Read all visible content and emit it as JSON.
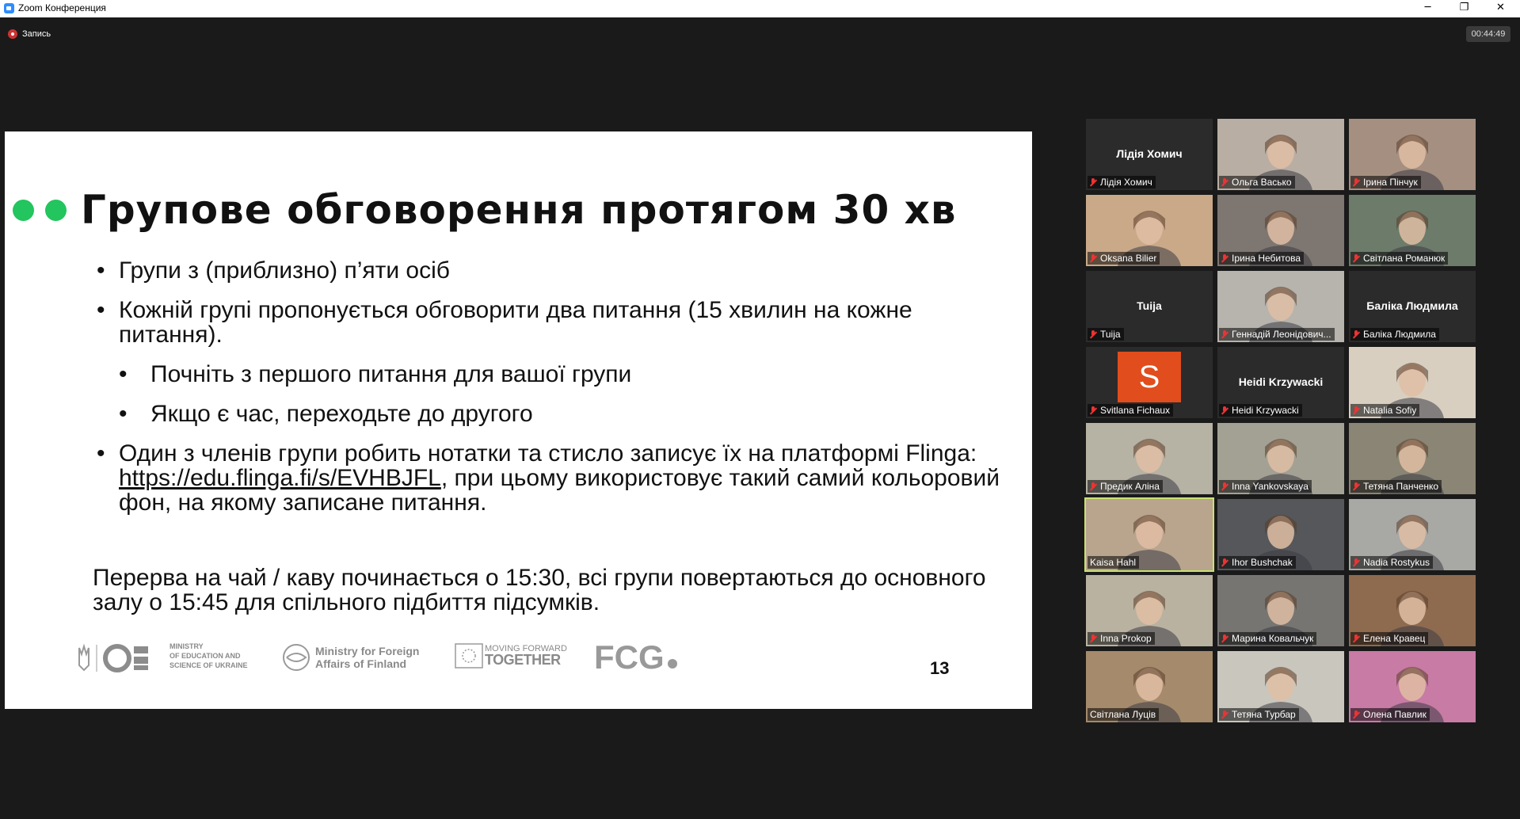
{
  "window": {
    "title": "Zoom Конференция",
    "controls": {
      "minimize": "─",
      "restore": "❐",
      "close": "✕"
    }
  },
  "recording": {
    "label": "Запись"
  },
  "timer": "00:44:49",
  "slide": {
    "title": "Групове обговорення протягом 30 хв",
    "bullets": {
      "b1": "Групи з (приблизно) п’яти осіб",
      "b2": "Кожній групі пропонується обговорити два питання (15 хвилин на кожне питання).",
      "b2a": "Почніть з першого питання для вашої групи",
      "b2b": "Якщо є час, переходьте до другого",
      "b3_pre": "Один з членів групи робить нотатки та стисло записує їх на платформі Flinga: ",
      "b3_link": "https://edu.flinga.fi/s/EVHBJFL",
      "b3_post": ", при цьому використовує такий самий кольоровий фон, на якому записане питання."
    },
    "note": "Перерва на чай / каву починається о 15:30, всі групи повертаються до основного залу о 15:45 для спільного підбиття підсумків.",
    "logos": {
      "ministry_edu": [
        "MINISTRY",
        "OF EDUCATION AND",
        "SCIENCE OF UKRAINE"
      ],
      "ministry_foreign": [
        "Ministry for Foreign",
        "Affairs of Finland"
      ],
      "moving": [
        "MOVING FORWARD",
        "TOGETHER"
      ],
      "fcg": "FCG"
    },
    "page_number": "13"
  },
  "participants": [
    {
      "name": "Лідія Хомич",
      "display": "Лідія Хомич",
      "video": false,
      "muted": true
    },
    {
      "name": "Ольга Васько",
      "video": true,
      "muted": true,
      "bg": "#b9aea3"
    },
    {
      "name": "Ірина Пінчук",
      "video": true,
      "muted": true,
      "bg": "#a58f80"
    },
    {
      "name": "Oksana Bilier",
      "video": true,
      "muted": true,
      "bg": "#c9a988"
    },
    {
      "name": "Ірина Небитова",
      "video": true,
      "muted": true,
      "bg": "#7e7670"
    },
    {
      "name": "Світлана Романюк",
      "video": true,
      "muted": true,
      "bg": "#6d7b6a"
    },
    {
      "name": "Tuija",
      "display": "Tuija",
      "video": false,
      "muted": true
    },
    {
      "name": "Геннадій Леонідович...",
      "video": true,
      "muted": true,
      "bg": "#b7b3ad"
    },
    {
      "name": "Баліка Людмила",
      "display": "Баліка Людмила",
      "video": false,
      "muted": true
    },
    {
      "name": "Svitlana Fichaux",
      "avatar": "S",
      "video": false,
      "muted": true
    },
    {
      "name": "Heidi Krzywacki",
      "display": "Heidi Krzywacki",
      "video": false,
      "muted": true
    },
    {
      "name": "Natalia Sofiy",
      "video": true,
      "muted": true,
      "bg": "#d8cfc0"
    },
    {
      "name": "Предик Аліна",
      "video": true,
      "muted": true,
      "bg": "#b6b2a4"
    },
    {
      "name": "Inna Yankovskaya",
      "video": true,
      "muted": true,
      "bg": "#a3a193"
    },
    {
      "name": "Тетяна Панченко",
      "video": true,
      "muted": true,
      "bg": "#8a8574"
    },
    {
      "name": "Kaisa Hahl",
      "video": true,
      "muted": false,
      "speaking": true,
      "bg": "#b9a48e"
    },
    {
      "name": "Ihor Bushchak",
      "video": true,
      "muted": true,
      "bg": "#55575a"
    },
    {
      "name": "Nadia Rostykus",
      "video": true,
      "muted": true,
      "bg": "#a8a8a4"
    },
    {
      "name": "Inna Prokop",
      "video": true,
      "muted": true,
      "bg": "#b9b2a0"
    },
    {
      "name": "Марина Ковальчук",
      "video": true,
      "muted": true,
      "bg": "#767571"
    },
    {
      "name": "Елена Кравец",
      "video": true,
      "muted": true,
      "bg": "#8e6a4f"
    },
    {
      "name": "Світлана Луців",
      "video": true,
      "muted": false,
      "bg": "#a58a6c"
    },
    {
      "name": "Тетяна Турбар",
      "video": true,
      "muted": true,
      "bg": "#c9c6bd"
    },
    {
      "name": "Олена Павлик",
      "video": true,
      "muted": true,
      "bg": "#c87ba4"
    }
  ]
}
